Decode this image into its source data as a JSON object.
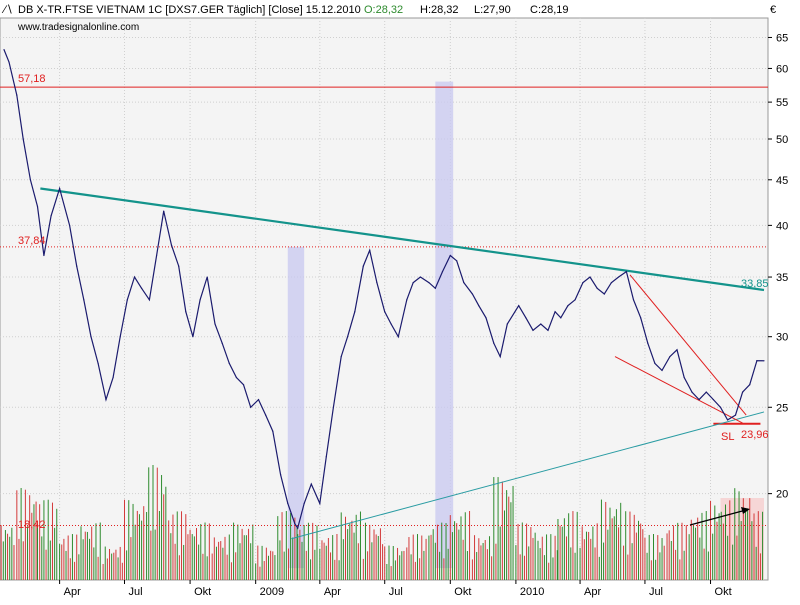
{
  "header": {
    "symbol": "DB X-TR.FTSE VIETNAM 1C [DXS7.GER  Täglich] [Close] 15.12.2010",
    "open": "O:28,32",
    "high": "H:28,32",
    "low": "L:27,90",
    "close": "C:28,19",
    "website": "www.tradesignalonline.com",
    "currency": "€"
  },
  "annotations": {
    "level_high": "57,18",
    "level_mid": "37,84",
    "level_low": "18,42",
    "trend_end": "33,85",
    "stop_loss_label": "SL",
    "stop_loss_value": "23,96"
  },
  "colors": {
    "background": "#ffffff",
    "plot_bg": "#f4f4f4",
    "price_line": "#1b1b6e",
    "resistance_line": "#13938b",
    "support_line": "#2a9ca3",
    "red_lines": "#e02020",
    "highlight_band": "#c8c8f0",
    "volume_up": "#2e8b2e",
    "volume_down": "#d33a3a"
  },
  "chart_data": {
    "type": "line",
    "title": "DB X-TR.FTSE VIETNAM 1C [DXS7.GER  Täglich] [Close] 15.12.2010",
    "ylabel": "€",
    "y_scale": "log",
    "ylim": [
      16,
      68
    ],
    "y_ticks": [
      "20",
      "25",
      "30",
      "35",
      "40",
      "45",
      "50",
      "55",
      "60",
      "65"
    ],
    "x_ticks": [
      "Apr",
      "Jul",
      "Okt",
      "2009",
      "Apr",
      "Jul",
      "Okt",
      "2010",
      "Apr",
      "Jul",
      "Okt"
    ],
    "x_tick_dates": [
      "2008-04-01",
      "2008-07-01",
      "2008-10-01",
      "2009-01-01",
      "2009-04-01",
      "2009-07-01",
      "2009-10-01",
      "2010-01-01",
      "2010-04-01",
      "2010-07-01",
      "2010-10-01"
    ],
    "x_range": [
      "2008-01-14",
      "2010-12-15"
    ],
    "grid": true,
    "series": [
      {
        "name": "DB X-TR.FTSE VIETNAM 1C",
        "x": [
          "2008-01-14",
          "2008-01-21",
          "2008-02-01",
          "2008-02-10",
          "2008-02-20",
          "2008-03-01",
          "2008-03-10",
          "2008-03-20",
          "2008-04-01",
          "2008-04-15",
          "2008-04-25",
          "2008-05-05",
          "2008-05-15",
          "2008-05-25",
          "2008-06-05",
          "2008-06-15",
          "2008-06-25",
          "2008-07-05",
          "2008-07-15",
          "2008-07-25",
          "2008-08-05",
          "2008-08-15",
          "2008-08-25",
          "2008-09-05",
          "2008-09-15",
          "2008-09-25",
          "2008-10-05",
          "2008-10-15",
          "2008-10-25",
          "2008-11-05",
          "2008-11-15",
          "2008-11-25",
          "2008-12-05",
          "2008-12-15",
          "2008-12-25",
          "2009-01-05",
          "2009-01-15",
          "2009-01-25",
          "2009-02-05",
          "2009-02-15",
          "2009-02-25",
          "2009-03-01",
          "2009-03-10",
          "2009-03-20",
          "2009-04-01",
          "2009-04-10",
          "2009-04-20",
          "2009-05-01",
          "2009-05-10",
          "2009-05-20",
          "2009-06-01",
          "2009-06-10",
          "2009-06-20",
          "2009-07-01",
          "2009-07-10",
          "2009-07-20",
          "2009-08-01",
          "2009-08-10",
          "2009-08-20",
          "2009-09-01",
          "2009-09-10",
          "2009-09-20",
          "2009-10-01",
          "2009-10-10",
          "2009-10-20",
          "2009-11-01",
          "2009-11-10",
          "2009-11-20",
          "2009-12-01",
          "2009-12-10",
          "2009-12-20",
          "2010-01-05",
          "2010-01-15",
          "2010-01-25",
          "2010-02-05",
          "2010-02-15",
          "2010-02-25",
          "2010-03-05",
          "2010-03-15",
          "2010-03-25",
          "2010-04-05",
          "2010-04-15",
          "2010-04-25",
          "2010-05-05",
          "2010-05-15",
          "2010-05-25",
          "2010-06-05",
          "2010-06-15",
          "2010-06-25",
          "2010-07-05",
          "2010-07-15",
          "2010-07-25",
          "2010-08-05",
          "2010-08-15",
          "2010-08-25",
          "2010-09-05",
          "2010-09-15",
          "2010-09-25",
          "2010-10-05",
          "2010-10-15",
          "2010-10-25",
          "2010-11-05",
          "2010-11-15",
          "2010-11-25",
          "2010-12-05",
          "2010-12-15"
        ],
        "y": [
          63,
          61,
          56,
          50,
          45,
          42,
          37,
          41,
          44,
          40,
          36,
          33,
          30,
          28,
          25.5,
          27,
          30,
          33,
          35,
          34,
          33,
          37,
          41.5,
          38,
          36,
          32,
          30,
          33,
          35,
          31,
          29.5,
          28,
          27,
          26.5,
          25,
          25.5,
          24.5,
          23.5,
          21,
          19.5,
          18.5,
          18.3,
          19.5,
          20.5,
          19.5,
          22,
          25,
          28.5,
          30,
          32,
          36,
          37.5,
          34.5,
          32,
          31,
          30,
          33,
          34.5,
          35,
          34.5,
          34,
          35.5,
          37,
          36.5,
          34.5,
          33.5,
          32.5,
          31.5,
          29.5,
          28.5,
          31,
          32.5,
          31.5,
          30.5,
          31,
          30.5,
          32,
          31.5,
          32.5,
          33,
          34.5,
          35,
          34,
          33.5,
          34.5,
          35,
          35.5,
          33,
          31.5,
          29.5,
          28,
          27.5,
          28.5,
          29,
          27,
          26,
          25.5,
          26,
          25.5,
          25,
          24.2,
          24.5,
          26,
          26.5,
          28.2,
          28.19
        ]
      }
    ],
    "horizontal_levels": [
      {
        "value": 57.18,
        "label": "57,18",
        "style": "solid",
        "color": "#e02020"
      },
      {
        "value": 37.84,
        "label": "37,84",
        "style": "dotted",
        "color": "#e02020"
      },
      {
        "value": 18.42,
        "label": "18,42",
        "style": "dotted",
        "color": "#e02020"
      },
      {
        "value": 23.96,
        "label": "23,96",
        "style": "solid",
        "color": "#e02020"
      }
    ],
    "trendlines": [
      {
        "kind": "resistance",
        "color": "#13938b",
        "from": [
          "2008-03-05",
          44
        ],
        "to": [
          "2010-12-15",
          33.85
        ],
        "label": "33,85"
      },
      {
        "kind": "support",
        "color": "#2a9ca3",
        "from": [
          "2009-02-20",
          17.8
        ],
        "to": [
          "2010-12-15",
          24.7
        ]
      },
      {
        "kind": "channel-upper",
        "color": "#e02020",
        "from": [
          "2010-06-10",
          35.2
        ],
        "to": [
          "2010-11-20",
          24.5
        ]
      },
      {
        "kind": "channel-lower",
        "color": "#e02020",
        "from": [
          "2010-05-20",
          28.5
        ],
        "to": [
          "2010-11-15",
          24.0
        ]
      }
    ],
    "highlight_bands": [
      {
        "from": "2009-02-15",
        "to": "2009-03-10",
        "y_top": 37.84
      },
      {
        "from": "2009-09-10",
        "to": "2009-10-05",
        "y_top": 58
      }
    ],
    "volume_highlight": {
      "from": "2010-10-15",
      "to": "2010-12-15"
    },
    "volume": {
      "x": [
        "2008-01",
        "2008-02",
        "2008-03",
        "2008-04",
        "2008-05",
        "2008-06",
        "2008-07",
        "2008-08",
        "2008-09",
        "2008-10",
        "2008-11",
        "2008-12",
        "2009-01",
        "2009-02",
        "2009-03",
        "2009-04",
        "2009-05",
        "2009-06",
        "2009-07",
        "2009-08",
        "2009-09",
        "2009-10",
        "2009-11",
        "2009-12",
        "2010-01",
        "2010-02",
        "2010-03",
        "2010-04",
        "2010-05",
        "2010-06",
        "2010-07",
        "2010-08",
        "2010-09",
        "2010-10",
        "2010-11",
        "2010-12"
      ],
      "values": [
        0.5,
        0.8,
        0.7,
        0.4,
        0.5,
        0.3,
        0.7,
        1.0,
        0.6,
        0.5,
        0.4,
        0.5,
        0.3,
        0.6,
        0.5,
        0.4,
        0.6,
        0.5,
        0.3,
        0.4,
        0.5,
        0.6,
        0.4,
        0.9,
        0.5,
        0.4,
        0.6,
        0.5,
        0.7,
        0.6,
        0.4,
        0.5,
        0.6,
        0.7,
        0.8,
        0.6
      ],
      "direction": [
        "up",
        "down",
        "up",
        "down",
        "up",
        "down",
        "up",
        "up",
        "down",
        "up",
        "down",
        "up",
        "down",
        "up",
        "up",
        "down",
        "up",
        "down",
        "up",
        "down",
        "up",
        "up",
        "down",
        "up",
        "down",
        "up",
        "up",
        "down",
        "up",
        "down",
        "up",
        "down",
        "up",
        "up",
        "up",
        "down"
      ]
    }
  }
}
